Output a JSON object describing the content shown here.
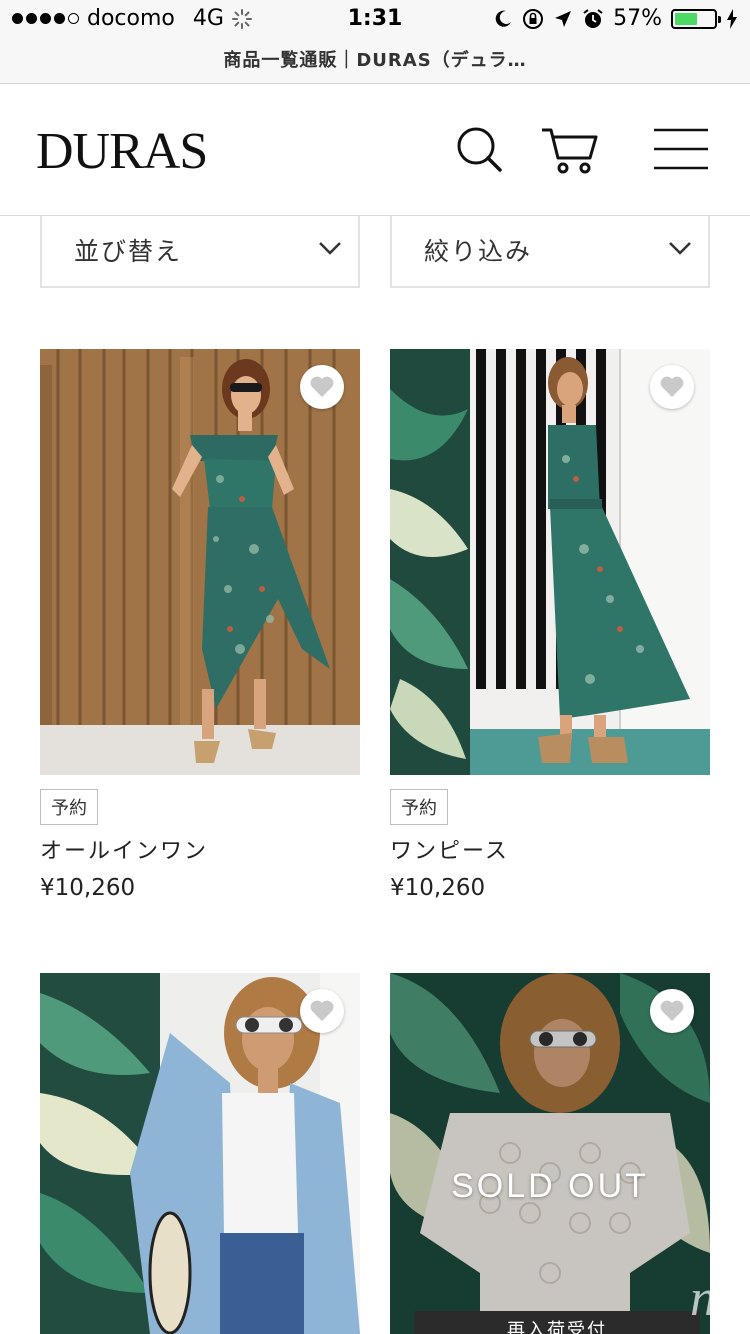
{
  "status_bar": {
    "carrier": "docomo",
    "network": "4G",
    "time": "1:31",
    "battery": "57%",
    "battery_level": 0.57
  },
  "browser": {
    "url_title": "商品一覧通販｜DURAS（デュラ…"
  },
  "header": {
    "logo": "DURAS",
    "icons": [
      "search-icon",
      "cart-icon",
      "menu-icon"
    ]
  },
  "filters": {
    "sort_label": "並び替え",
    "narrow_label": "絞り込み"
  },
  "products": [
    {
      "badge": "予約",
      "name": "オールインワン",
      "price": "¥10,260"
    },
    {
      "badge": "予約",
      "name": "ワンピース",
      "price": "¥10,260"
    },
    {},
    {
      "overlay": "SOLD OUT",
      "restock_button": "再入荷受付"
    }
  ],
  "watermark": "nn",
  "colors": {
    "battery": "#4cd964",
    "accent": "#111111"
  }
}
